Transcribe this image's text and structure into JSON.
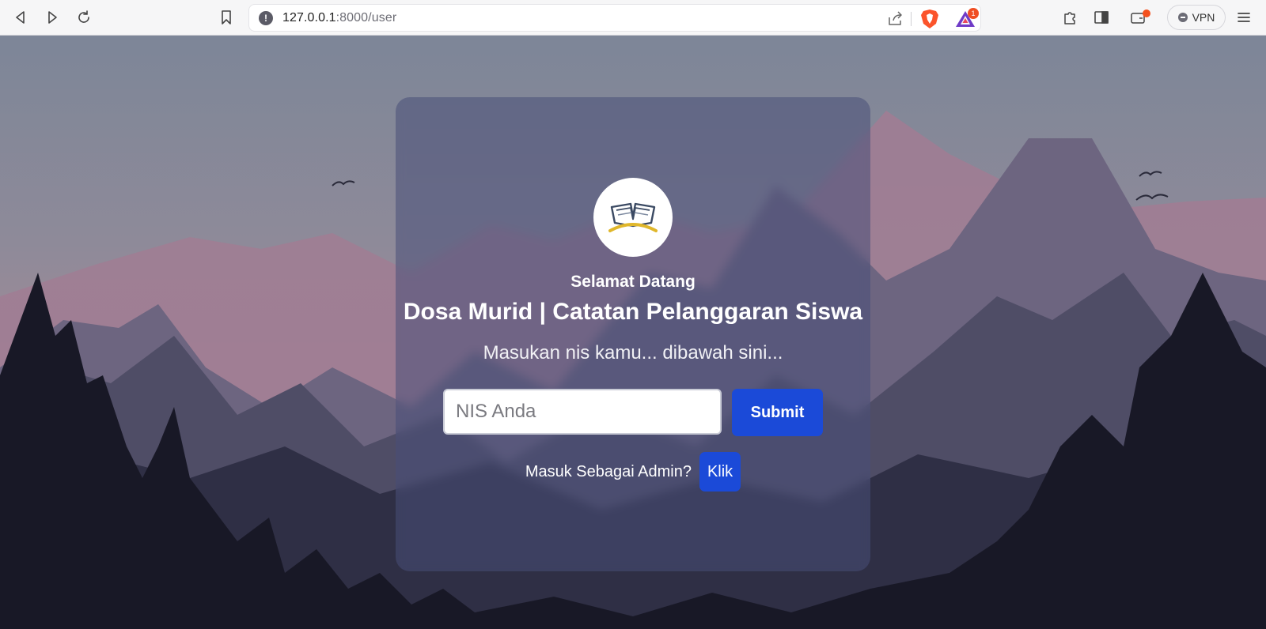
{
  "browser": {
    "url_host": "127.0.0.1",
    "url_path": ":8000/user",
    "rewards_badge": "1",
    "vpn_label": "VPN",
    "icons": [
      "back-icon",
      "forward-icon",
      "reload-icon",
      "bookmark-icon",
      "site-info-icon",
      "share-icon",
      "brave-shields-icon",
      "brave-rewards-icon",
      "extensions-icon",
      "sidebar-icon",
      "wallet-icon",
      "menu-icon"
    ]
  },
  "card": {
    "welcome": "Selamat Datang",
    "title": "Dosa Murid | Catatan Pelanggaran Siswa",
    "subtitle": "Masukan nis kamu... dibawah sini...",
    "nis_placeholder": "NIS Anda",
    "nis_value": "",
    "submit_label": "Submit",
    "admin_prompt": "Masuk Sebagai Admin?",
    "admin_button": "Klik"
  },
  "colors": {
    "accent": "#1b4ad8",
    "logo_gold": "#e0b72b",
    "logo_navy": "#3b4a63"
  }
}
